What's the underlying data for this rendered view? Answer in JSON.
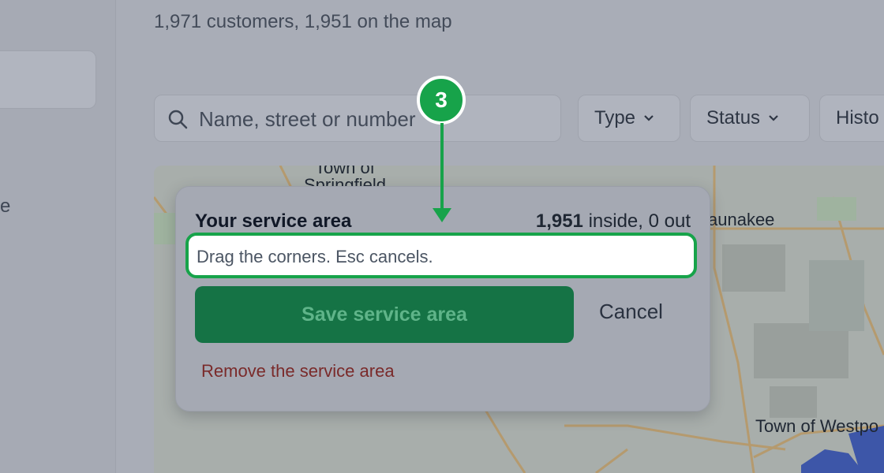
{
  "header": {
    "summary": "1,971 customers, 1,951 on the map"
  },
  "left_rail": {
    "partial_text": "e"
  },
  "search": {
    "placeholder": "Name, street or number"
  },
  "filters": [
    {
      "label": "Type"
    },
    {
      "label": "Status"
    },
    {
      "label": "Histo"
    }
  ],
  "map": {
    "labels": {
      "springfield_line1": "Town of",
      "springfield_line2": "Springfield",
      "waunakee": "aunakee",
      "westport": "Town of Westpo"
    }
  },
  "popup": {
    "title": "Your service area",
    "count_value": "1,951",
    "count_rest": " inside, 0 out",
    "hint": "Drag the corners. Esc cancels.",
    "save_label": "Save service area",
    "cancel_label": "Cancel",
    "remove_label": "Remove the service area"
  },
  "annotation": {
    "step": "3"
  },
  "colors": {
    "accent_green": "#17a34a",
    "primary_button": "#157345",
    "danger_text": "#7a2a2a"
  }
}
